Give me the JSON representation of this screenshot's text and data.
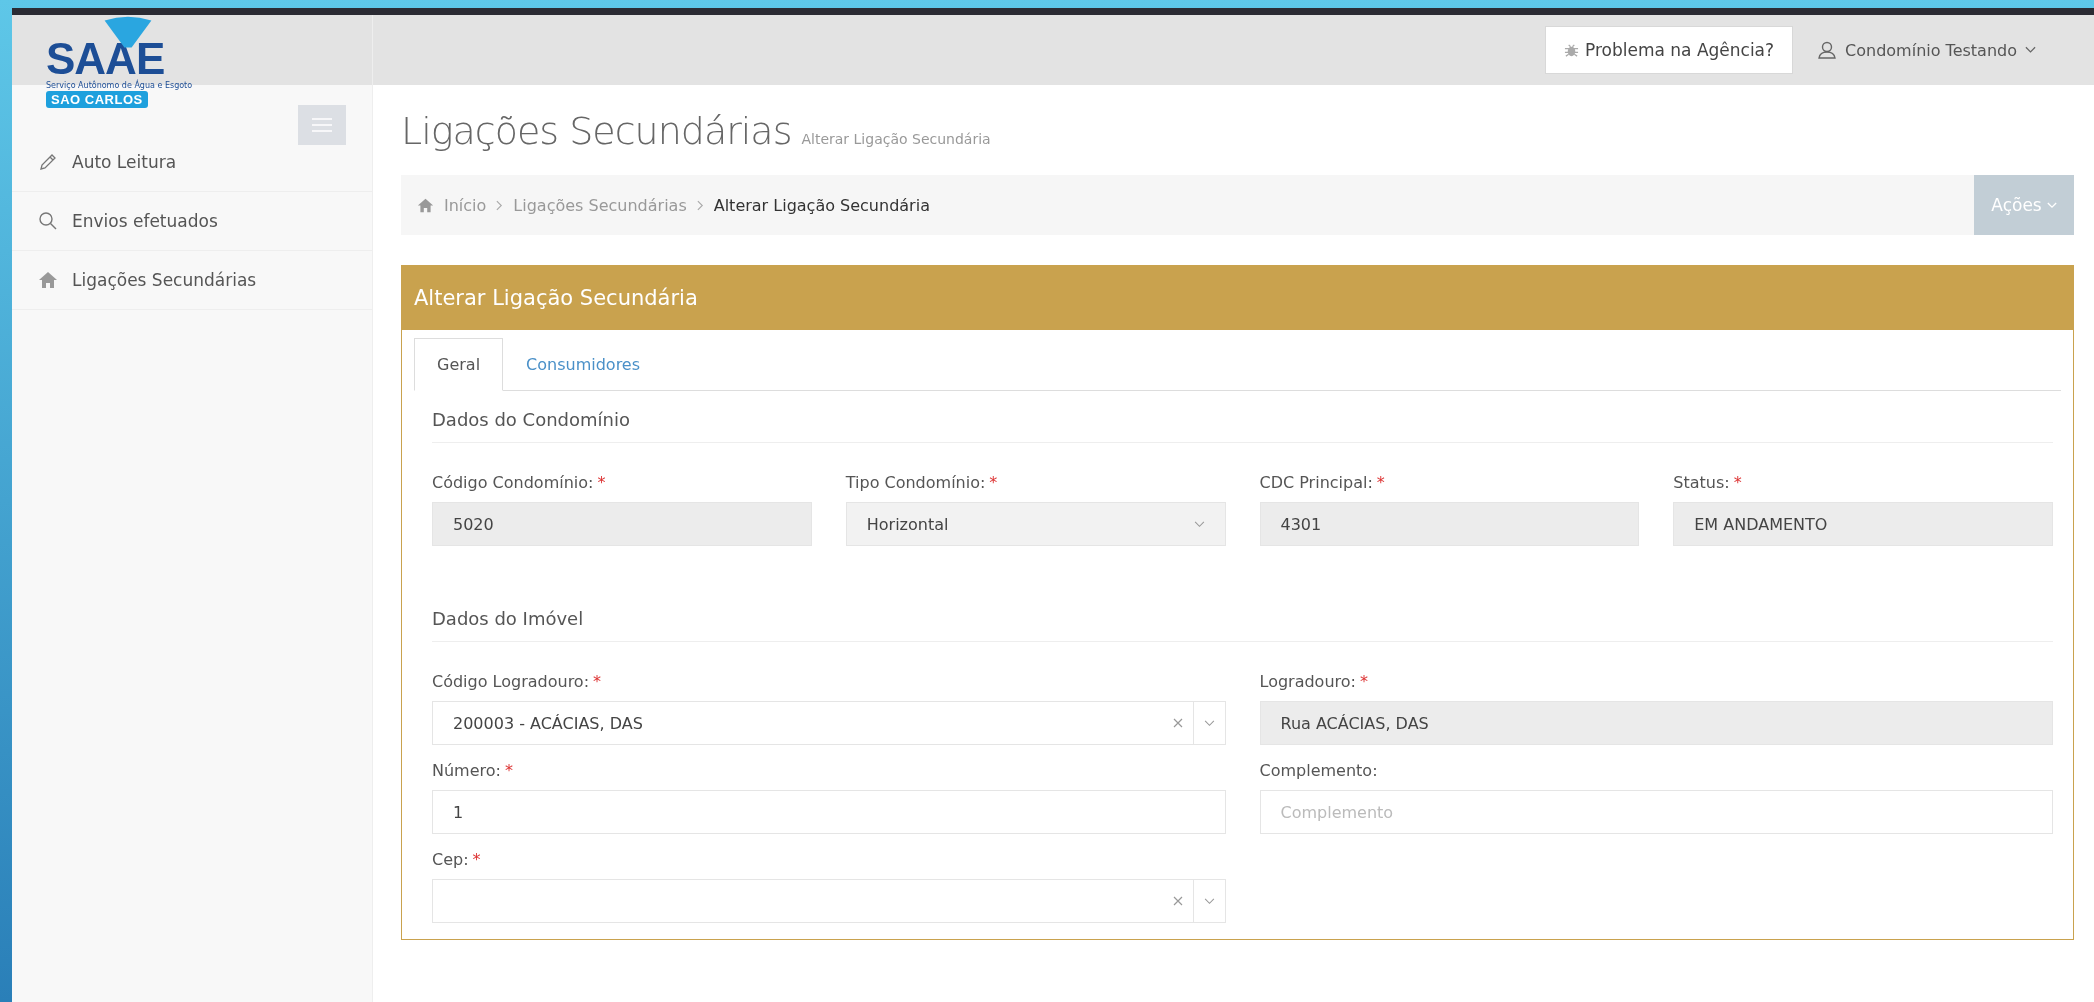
{
  "logo": {
    "name": "SAAE",
    "tagline": "Serviço Autônomo de Água e Esgoto",
    "city": "SAO CARLOS"
  },
  "header": {
    "problem_button": "Problema na Agência?",
    "user_menu": "Condomínio Testando"
  },
  "sidebar": {
    "items": [
      {
        "label": "Auto Leitura",
        "kind": "pencil"
      },
      {
        "label": "Envios efetuados",
        "kind": "search"
      },
      {
        "label": "Ligações Secundárias",
        "kind": "home"
      }
    ]
  },
  "page": {
    "title": "Ligações Secundárias",
    "subtitle": "Alterar Ligação Secundária"
  },
  "breadcrumb": [
    "Início",
    "Ligações Secundárias",
    "Alterar Ligação Secundária"
  ],
  "actions_button": {
    "label": "Ações",
    "disabled": true
  },
  "panel": {
    "title": "Alterar Ligação Secundária",
    "tabs": [
      {
        "label": "Geral",
        "selected": true
      },
      {
        "label": "Consumidores",
        "selected": false
      }
    ],
    "sections": [
      {
        "title": "Dados do Condomínio",
        "rows": [
          [
            {
              "label": "Código Condomínio:",
              "required_mark": "*",
              "kind": "readonly",
              "value": "5020"
            },
            {
              "label": "Tipo Condomínio:",
              "required_mark": "*",
              "kind": "select",
              "value": "Horizontal"
            },
            {
              "label": "CDC Principal:",
              "required_mark": "*",
              "kind": "readonly",
              "value": "4301"
            },
            {
              "label": "Status:",
              "required_mark": "*",
              "kind": "readonly",
              "value": "EM ANDAMENTO"
            }
          ]
        ]
      },
      {
        "title": "Dados do Imóvel",
        "rows": [
          [
            {
              "label": "Código Logradouro:",
              "required_mark": "*",
              "kind": "combo",
              "value": "200003 - ACÁCIAS, DAS"
            },
            {
              "label": "Logradouro:",
              "required_mark": "*",
              "kind": "readonly",
              "value": "Rua ACÁCIAS, DAS"
            }
          ],
          [
            {
              "label": "Número:",
              "required_mark": "*",
              "kind": "input",
              "value": "1"
            },
            {
              "label": "Complemento:",
              "kind": "input",
              "placeholder": "Complemento"
            }
          ],
          [
            {
              "label": "Cep:",
              "required_mark": "*",
              "kind": "combo"
            }
          ]
        ]
      }
    ]
  }
}
